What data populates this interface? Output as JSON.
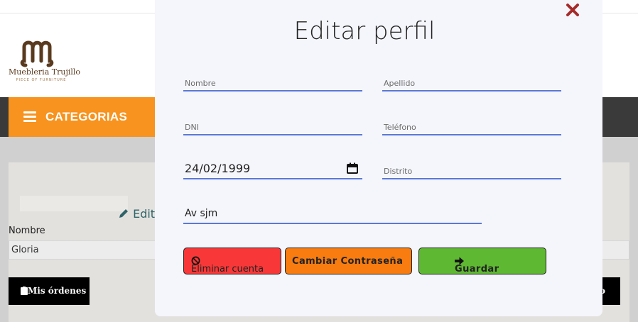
{
  "brand": {
    "name": "Muebleria Trujillo",
    "tagline": "PIECE OF FURNITURE",
    "accent": "#5a3a1e"
  },
  "nav": {
    "categories_label": "CATEGORIAS",
    "accent": "#f7931e"
  },
  "profile_page": {
    "edit_link": "Edit",
    "nombre_label": "Nombre",
    "nombre_value": "Gloria",
    "orders_button": "Mis órdenes",
    "right_button_fragment": "o"
  },
  "modal": {
    "title": "Editar perfil",
    "fields": {
      "nombre": {
        "placeholder": "Nombre",
        "value": ""
      },
      "apellido": {
        "placeholder": "Apellido",
        "value": ""
      },
      "dni": {
        "placeholder": "DNI",
        "value": ""
      },
      "telefono": {
        "placeholder": "Teléfono",
        "value": ""
      },
      "fecha": {
        "value": "24/02/1999"
      },
      "distrito": {
        "placeholder": "Distrito",
        "value": ""
      },
      "direccion": {
        "value": "Av sjm"
      }
    },
    "buttons": {
      "delete": "Eliminar cuenta",
      "change_password": "Cambiar Contraseña",
      "save": "Guardar"
    },
    "icons": [
      "close-icon",
      "calendar-icon",
      "ban-icon",
      "arrow-right-icon"
    ],
    "colors": {
      "delete": "#f83838",
      "change_password": "#f87c10",
      "save": "#5fb832",
      "underline": "#5b78d6",
      "close": "#a52a2a"
    }
  }
}
